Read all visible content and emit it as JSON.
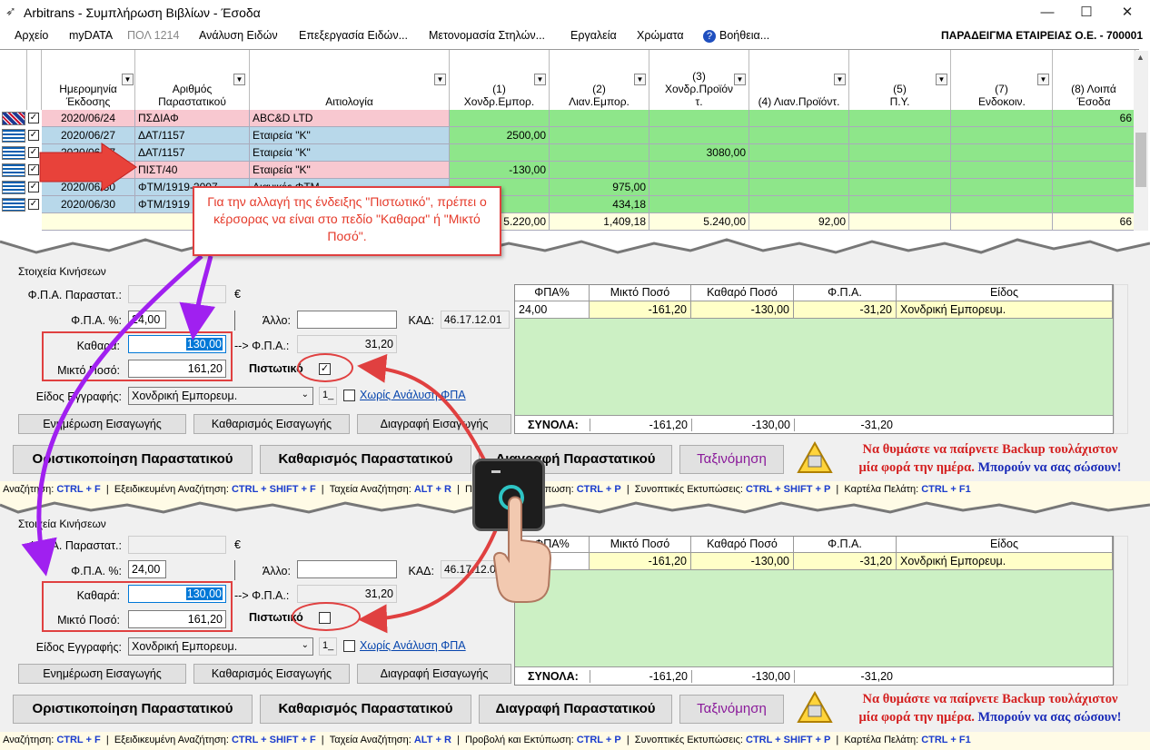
{
  "window": {
    "title": "Arbitrans - Συμπλήρωση Βιβλίων - Έσοδα",
    "minimize": "—",
    "maximize": "☐",
    "close": "✕"
  },
  "menu": {
    "items": [
      "Αρχείο",
      "myDATA",
      "ΠΟΛ 1214",
      "Ανάλυση Ειδών",
      "Επεξεργασία Ειδών...",
      "Μετονομασία Στηλών...",
      "Εργαλεία",
      "Χρώματα",
      "Βοήθεια..."
    ],
    "company": "ΠΑΡΑΔΕΙΓΜΑ ΕΤΑΙΡΕΙΑΣ Ο.Ε. - 700001"
  },
  "grid": {
    "headers": {
      "date": "Ημερομηνία Έκδοσης",
      "docnum": "Αριθμός Παραστατικού",
      "reason": "Αιτιολογία",
      "c1": "(1) Χονδρ.Εμπορ.",
      "c2": "(2) Λιαν.Εμπορ.",
      "c3": "(3) Χονδρ.Προϊόν τ.",
      "c4": "(4) Λιαν.Προϊόντ.",
      "c5": "(5) Π.Υ.",
      "c7": "(7) Ενδοκοιν.",
      "c8": "(8) Λοιπά Έσοδα"
    },
    "rows": [
      {
        "date": "2020/06/24",
        "docnum": "ΠΣΔΙΑΦ",
        "reason": "ABC&D LTD",
        "c1": "",
        "c2": "",
        "c3": "",
        "c8": "66"
      },
      {
        "date": "2020/06/27",
        "docnum": "ΔΑΤ/1157",
        "reason": "Εταιρεία \"Κ\"",
        "c1": "2500,00",
        "c2": "",
        "c3": "",
        "c8": ""
      },
      {
        "date": "2020/06/27",
        "docnum": "ΔΑΤ/1157",
        "reason": "Εταιρεία \"Κ\"",
        "c1": "",
        "c2": "",
        "c3": "3080,00",
        "c8": ""
      },
      {
        "date": "2020/06/27",
        "docnum": "ΠΙΣΤ/40",
        "reason": "Εταιρεία \"Κ\"",
        "c1": "-130,00",
        "c2": "",
        "c3": "",
        "c8": ""
      },
      {
        "date": "2020/06/30",
        "docnum": "ΦΤΜ/1919-2007",
        "reason": "Λιανικές ΦΤΜ",
        "c1": "",
        "c2": "975,00",
        "c3": "",
        "c8": ""
      },
      {
        "date": "2020/06/30",
        "docnum": "ΦΤΜ/1919",
        "reason": "",
        "c1": "",
        "c2": "434,18",
        "c3": "",
        "c8": ""
      }
    ],
    "totals": {
      "label": "Γ",
      "c1": "5.220,00",
      "c2": "1,409,18",
      "c3": "5.240,00",
      "c4": "92,00",
      "c8": "66"
    }
  },
  "callout": {
    "text": "Για την αλλαγή της ένδειξης \"Πιστωτικό\", πρέπει ο κέρσορας να είναι στο πεδίο \"Καθαρα\" ή \"Μικτό Ποσό\"."
  },
  "form": {
    "section_title": "Στοιχεία Κινήσεων",
    "vat_doc_label": "Φ.Π.Α. Παραστατ.:",
    "currency": "€",
    "vat_pct_label": "Φ.Π.Α. %:",
    "vat_pct": "24,00",
    "other_label": "Άλλο:",
    "kad_label": "ΚΑΔ:",
    "kad": "46.17.12.01",
    "net_label": "Καθαρά:",
    "net": "130,00",
    "arrow_vat_label": "--> Φ.Π.Α.:",
    "vat_amount": "31,20",
    "gross_label": "Μικτό Ποσό:",
    "gross": "161,20",
    "credit_label": "Πιστωτικό",
    "type_label": "Είδος Εγγραφής:",
    "type_value": "Χονδρική Εμπορευμ.",
    "type_code": "1_",
    "no_analysis": "Χωρίς Ανάλυση ΦΠΑ",
    "btn_update": "Ενημέρωση Εισαγωγής",
    "btn_clear": "Καθαρισμός Εισαγωγής",
    "btn_delete": "Διαγραφή Εισαγωγής"
  },
  "lines": {
    "headers": [
      "ΦΠΑ%",
      "Μικτό Ποσό",
      "Καθαρό Ποσό",
      "Φ.Π.Α.",
      "Είδος"
    ],
    "row": {
      "pct": "24,00",
      "gross": "-161,20",
      "net": "-130,00",
      "vat": "-31,20",
      "kind": "Χονδρική Εμπορευμ."
    },
    "totals_label": "ΣΥΝΟΛΑ:",
    "totals": {
      "gross": "-161,20",
      "net": "-130,00",
      "vat": "-31,20"
    }
  },
  "actions": {
    "finalize": "Οριστικοποίηση Παραστατικού",
    "clear": "Καθαρισμός Παραστατικού",
    "delete": "Διαγραφή Παραστατικού",
    "sort": "Ταξινόμηση",
    "warn1": "Να θυμάστε να παίρνετε Backup τουλάχιστον",
    "warn2a": "μία φορά την ημέρα.",
    "warn2b": "Μπορούν να σας σώσουν!"
  },
  "shortcuts": {
    "s1": "Αναζήτηση:",
    "k1": "CTRL + F",
    "s2": "Εξειδικευμένη Αναζήτηση:",
    "k2": "CTRL + SHIFT + F",
    "s3": "Ταχεία Αναζήτηση:",
    "k3": "ALT + R",
    "s4": "Προβολή και Εκτύπωση:",
    "k4": "CTRL + P",
    "s5": "Συνοπτικές Εκτυπώσεις:",
    "k5": "CTRL + SHIFT + P",
    "s6": "Καρτέλα Πελάτη:",
    "k6": "CTRL + F1"
  },
  "colors": {
    "pink": "#f8c8d0",
    "blue": "#b8d8ea",
    "green": "#8ee68a",
    "accent": "#e04040",
    "purple": "#a020f0"
  }
}
